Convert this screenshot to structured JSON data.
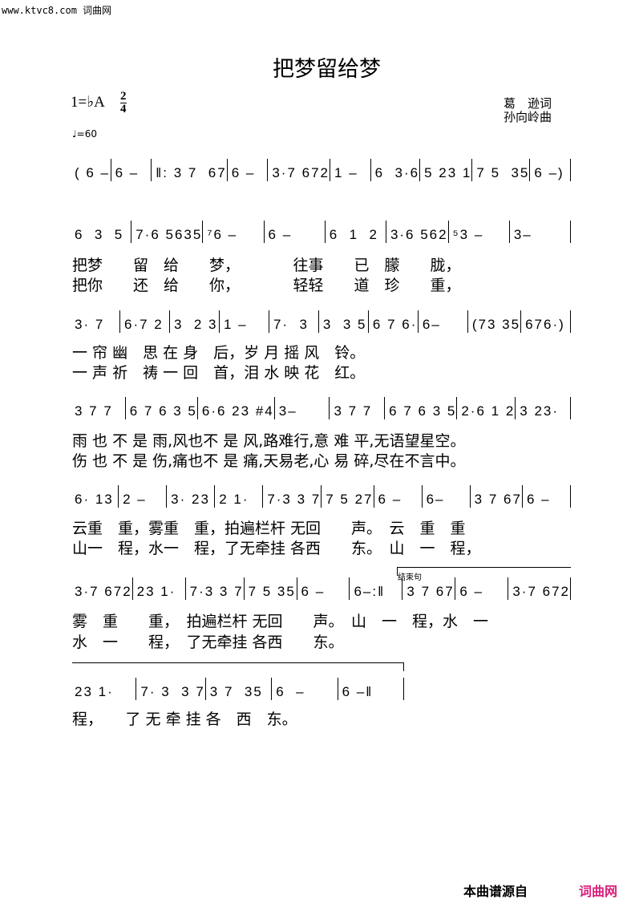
{
  "watermark": "www.ktvc8.com 词曲网",
  "title": "把梦留给梦",
  "key": "1=♭A",
  "time_signature": {
    "top": "2",
    "bottom": "4"
  },
  "lyricist": "葛　逊词",
  "composer": "孙向岭曲",
  "tempo": "♩=60",
  "ending_label": "结束句",
  "rows": [
    {
      "measures": [
        "( 6 –",
        "6 –",
        "‖: 3 7  67",
        "6 –",
        "3·7 672",
        "1 –",
        "6  3·6",
        "5 23 1",
        "7 5  35",
        "6 –)"
      ],
      "lyrics": []
    },
    {
      "measures": [
        "6  3  5",
        "7·6 5635",
        "⁷6 –",
        "6 –",
        "6  1  2",
        "3·6 562",
        "⁵3 –",
        "3–"
      ],
      "lyrics": [
        "把梦　　留　给　　梦，　　　　往事　　已　朦　　胧，",
        "把你　　还　给　　你，　　　　轻轻　　道　珍　　重，"
      ]
    },
    {
      "measures": [
        "3· 7",
        "6·7 2",
        "3  2 3",
        "1 –",
        "7·  3",
        "3  3 5",
        "6 7 6·",
        "6–",
        "(73 35",
        "676·)"
      ],
      "lyrics": [
        "一 帘 幽　思 在 身　后，岁 月 摇 风　铃。",
        "一 声 祈　祷 一 回　首，泪 水 映 花　红。"
      ]
    },
    {
      "measures": [
        "3 7 7",
        "6 7 6 3 5",
        "6·6 23 #4",
        "3–",
        "3 7 7",
        "6 7 6 3 5",
        "2·6 1 2",
        "3 23·"
      ],
      "lyrics": [
        "雨 也 不 是 雨,风也不 是 风,路难行,意 难 平,无语望星空。",
        "伤 也 不 是 伤,痛也不 是 痛,天易老,心 易 碎,尽在不言中。"
      ]
    },
    {
      "measures": [
        "6· 13",
        "2 –",
        "3· 23",
        "2 1·",
        "7·3 3 7",
        "7 5 27",
        "6 –",
        "6–",
        "3 7 67",
        "6 –"
      ],
      "lyrics": [
        "云重　重，雾重　重，拍遍栏杆 无回　　声。　云　重　重",
        "山一　程，水一　程，了无牵挂 各西　　东。　山　一　程，"
      ]
    },
    {
      "measures": [
        "3·7 672",
        "23 1·",
        "7·3 3 7",
        "7 5 35",
        "6 –",
        "6–:‖",
        "3 7 67",
        "6 –",
        "3·7 672"
      ],
      "lyrics": [
        "雾　重　　重，　拍遍栏杆 无回　　声。　山　一　程，水　一",
        "水　一　　程，　了无牵挂 各西　　东。"
      ]
    },
    {
      "measures": [
        "23 1·",
        "7· 3  3 7",
        "3 7  35",
        "6  –",
        "6 –‖"
      ],
      "lyrics": [
        "程，　　了 无 牵 挂 各　西　东。"
      ]
    }
  ],
  "footer": {
    "source_label": "本曲谱源自",
    "site": "词曲网",
    "site_color": "#d6207a"
  }
}
